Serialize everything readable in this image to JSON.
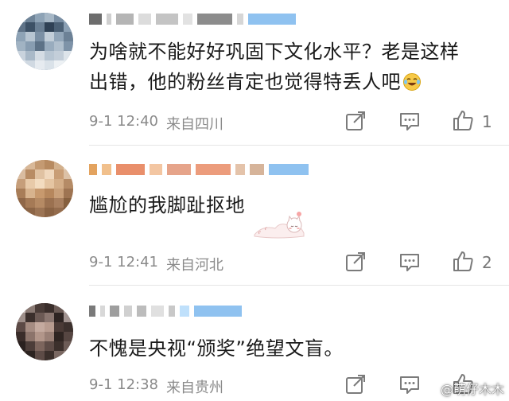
{
  "comments": [
    {
      "text_line1": "为啥就不能好好巩固下文化水平？老是这样",
      "text_line2": "出错，他的粉丝肯定也觉得特丢人吧",
      "time": "9-1 12:40",
      "location": "来自四川",
      "likes": "1"
    },
    {
      "text_line1": "尴尬的我脚趾抠地",
      "time": "9-1 12:41",
      "location": "来自河北",
      "likes": "2"
    },
    {
      "text_line1": "不愧是央视“颁奖”绝望文盲。",
      "time": "9-1 12:38",
      "location": "来自贵州",
      "likes": ""
    }
  ],
  "watermark": "@萌仔木木",
  "colors": {
    "accent_name": "#8fc2f0",
    "meta": "#8a8a8a",
    "text": "#1a1a1a"
  },
  "icons": [
    "share-icon",
    "comment-icon",
    "like-icon",
    "laughing-tears-emoji-icon",
    "cat-sticker-icon"
  ]
}
